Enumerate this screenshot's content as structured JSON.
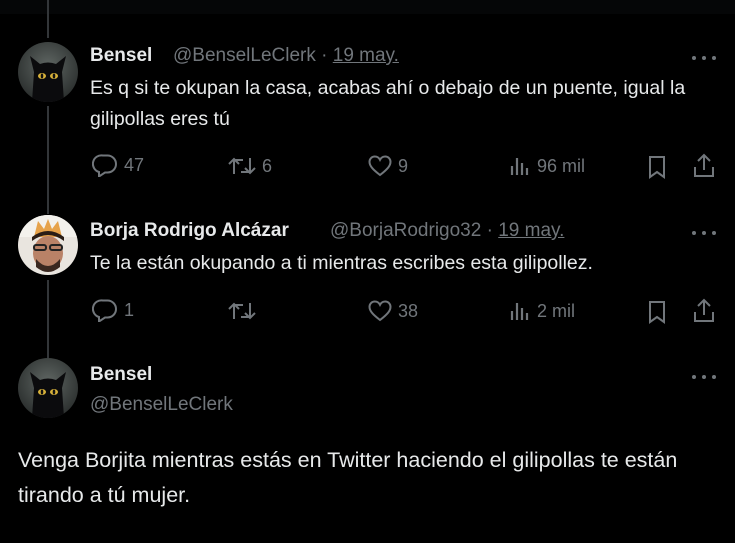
{
  "tweets": [
    {
      "name": "Bensel",
      "handle": "@BenselLeClerk",
      "sep": "·",
      "date": "19 may.",
      "text": "Es q si te okupan la casa, acabas ahí o debajo de un puente, igual la gilipollas eres tú",
      "replies": "47",
      "retweets": "6",
      "likes": "9",
      "views": "96 mil"
    },
    {
      "name": "Borja Rodrigo Alcázar",
      "handle": "@BorjaRodrigo32",
      "sep": "·",
      "date": "19 may.",
      "text": "Te la están okupando a ti mientras escribes esta gilipollez.",
      "replies": "1",
      "retweets": "",
      "likes": "38",
      "views": "2 mil"
    }
  ],
  "main_tweet": {
    "name": "Bensel",
    "handle": "@BenselLeClerk",
    "text": "Venga Borjita mientras estás en Twitter haciendo el gilipollas te están tirando a tú mujer."
  },
  "colors": {
    "background": "#000000",
    "text": "#e7e9ea",
    "muted": "#71767b",
    "thread_line": "#333639"
  },
  "icons": [
    "more-icon",
    "reply-icon",
    "retweet-icon",
    "like-icon",
    "views-icon",
    "bookmark-icon",
    "share-icon"
  ]
}
